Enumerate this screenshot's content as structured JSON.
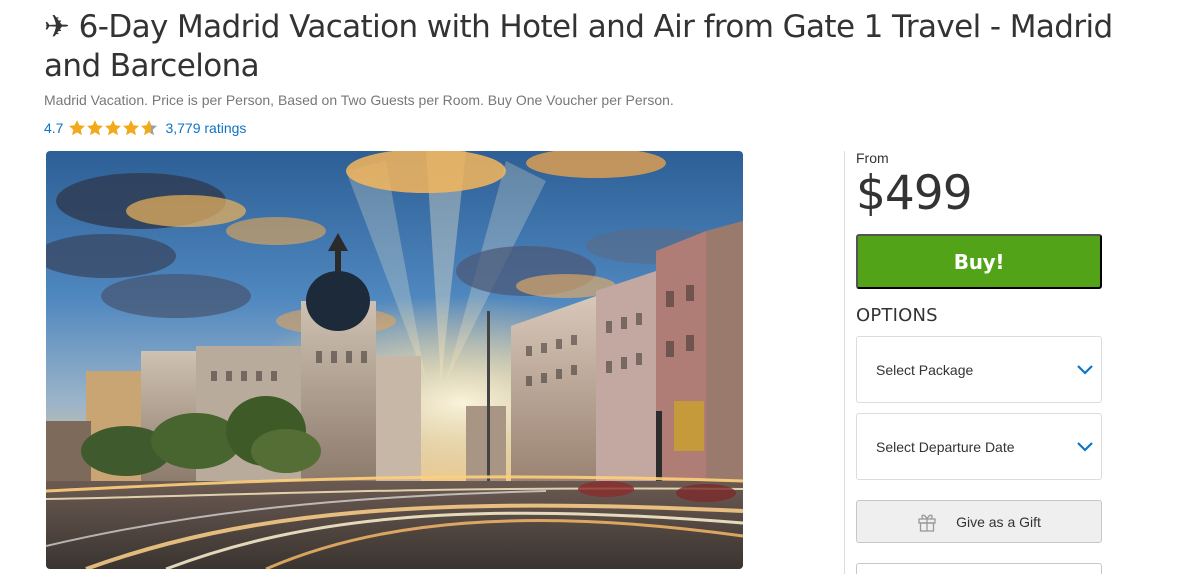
{
  "deal": {
    "title": "✈ 6-Day Madrid Vacation with Hotel and Air from Gate 1 Travel - Madrid and Barcelona",
    "subtitle": "Madrid Vacation. Price is per Person, Based on Two Guests per Room. Buy One Voucher per Person.",
    "rating": {
      "value": "4.7",
      "stars": 4.7,
      "count_label": "3,779 ratings"
    },
    "image": {
      "icon": "madrid-gran-via-photo"
    }
  },
  "purchase": {
    "from_label": "From",
    "price": "$499",
    "buy_label": "Buy!",
    "options_heading": "OPTIONS",
    "package_placeholder": "Select Package",
    "departure_placeholder": "Select Departure Date",
    "gift_label": "Give as a Gift"
  },
  "colors": {
    "accent_green": "#53a318",
    "link_blue": "#0d74c7",
    "star_gold": "#f2a91b",
    "text_dark": "#333333",
    "text_muted": "#75787b",
    "border": "#dcdcdc"
  },
  "icons": {
    "plane": "plane-icon",
    "star": "star-icon",
    "chevron": "chevron-down-icon",
    "gift": "gift-icon"
  }
}
